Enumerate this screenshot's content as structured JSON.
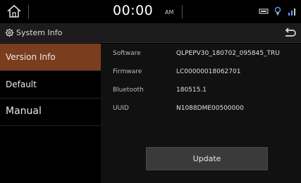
{
  "status": {
    "time": "00:00",
    "ampm": "AM",
    "icons": [
      "usb-icon",
      "bluetooth-audio-icon",
      "signal-icon"
    ]
  },
  "title": {
    "text": "System Info"
  },
  "sidebar": {
    "items": [
      {
        "label": "Version Info",
        "active": true
      },
      {
        "label": "Default",
        "active": false
      },
      {
        "label": "Manual",
        "active": false
      }
    ]
  },
  "info": {
    "rows": [
      {
        "label": "Software",
        "value": "QLPEPV30_180702_095845_TRU"
      },
      {
        "label": "Firmware",
        "value": "LC00000018062701"
      },
      {
        "label": "Bluetooth",
        "value": "180515.1"
      },
      {
        "label": "UUID",
        "value": "N1088DME00500000"
      }
    ]
  },
  "update_button": {
    "label": "Update"
  },
  "colors": {
    "active_item": "#7a3d1e",
    "background": "#000000",
    "content_bg": "#111111",
    "button_bg": "#3a3a3a"
  }
}
